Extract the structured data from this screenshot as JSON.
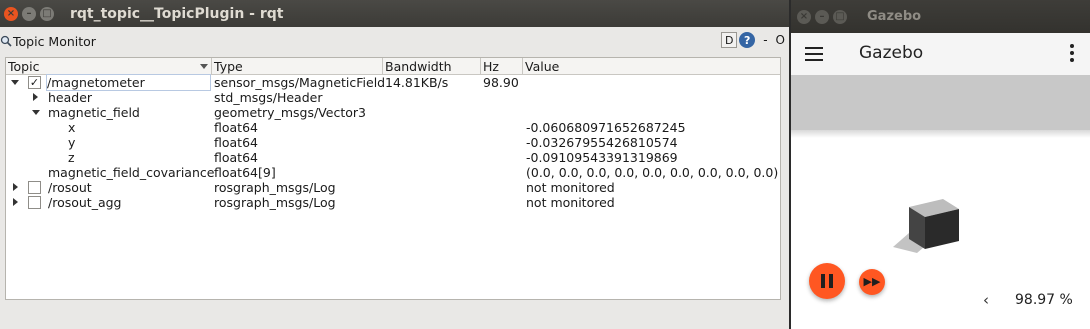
{
  "rqt": {
    "window_title": "rqt_topic__TopicPlugin - rqt",
    "plugin_title": "Topic Monitor",
    "d_button": "D",
    "help_button": "?",
    "minimize_label": "-",
    "close_label": "O",
    "columns": [
      "Topic",
      "Type",
      "Bandwidth",
      "Hz",
      "Value"
    ],
    "rows": [
      {
        "topic": "/magnetometer",
        "type": "sensor_msgs/MagneticField",
        "bandwidth": "14.81KB/s",
        "hz": "98.90",
        "value": "",
        "expanded": true,
        "checked": true
      },
      {
        "topic": "header",
        "type": "std_msgs/Header",
        "bandwidth": "",
        "hz": "",
        "value": ""
      },
      {
        "topic": "magnetic_field",
        "type": "geometry_msgs/Vector3",
        "bandwidth": "",
        "hz": "",
        "value": "",
        "expanded": true
      },
      {
        "topic": "x",
        "type": "float64",
        "bandwidth": "",
        "hz": "",
        "value": "-0.060680971652687245"
      },
      {
        "topic": "y",
        "type": "float64",
        "bandwidth": "",
        "hz": "",
        "value": "-0.03267955426810574"
      },
      {
        "topic": "z",
        "type": "float64",
        "bandwidth": "",
        "hz": "",
        "value": "-0.09109543391319869"
      },
      {
        "topic": "magnetic_field_covariance",
        "type": "float64[9]",
        "bandwidth": "",
        "hz": "",
        "value": "(0.0, 0.0, 0.0, 0.0, 0.0, 0.0, 0.0, 0.0, 0.0)"
      },
      {
        "topic": "/rosout",
        "type": "rosgraph_msgs/Log",
        "bandwidth": "",
        "hz": "",
        "value": "not monitored",
        "checked": false
      },
      {
        "topic": "/rosout_agg",
        "type": "rosgraph_msgs/Log",
        "bandwidth": "",
        "hz": "",
        "value": "not monitored",
        "checked": false
      }
    ]
  },
  "gazebo": {
    "window_title": "Gazebo",
    "app_title": "Gazebo",
    "real_time_factor": "98.97 %",
    "accent_color": "#ff5722"
  },
  "icons": {
    "close": "close-icon",
    "minimize": "minimize-icon",
    "maximize": "maximize-icon",
    "plugin": "magnifier-icon",
    "menu": "hamburger-icon",
    "more": "kebab-icon",
    "pause": "pause-icon",
    "step": "fast-forward-icon",
    "chevron": "chevron-left-icon"
  }
}
